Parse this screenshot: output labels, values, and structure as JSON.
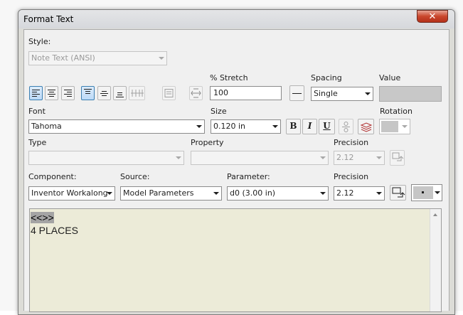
{
  "window": {
    "title": "Format Text",
    "close_glyph": "✕"
  },
  "style": {
    "label": "Style:",
    "value": "Note Text (ANSI)"
  },
  "stretch": {
    "label": "% Stretch",
    "value": "100"
  },
  "spacing": {
    "label": "Spacing",
    "value": "Single"
  },
  "value_field": {
    "label": "Value",
    "value": ""
  },
  "font": {
    "label": "Font",
    "value": "Tahoma"
  },
  "size": {
    "label": "Size",
    "value": "0.120 in"
  },
  "format_buttons": {
    "bold": "B",
    "italic": "I",
    "underline": "U"
  },
  "rotation": {
    "label": "Rotation"
  },
  "type": {
    "label": "Type",
    "value": ""
  },
  "property": {
    "label": "Property",
    "value": ""
  },
  "precision_top": {
    "label": "Precision",
    "value": "2.12"
  },
  "component": {
    "label": "Component:",
    "value": "Inventor Workalong"
  },
  "source": {
    "label": "Source:",
    "value": "Model Parameters"
  },
  "parameter": {
    "label": "Parameter:",
    "value": "d0 (3.00 in)"
  },
  "precision_bottom": {
    "label": "Precision",
    "value": "2.12"
  },
  "editor": {
    "line1": "<<>>",
    "line2": "4 PLACES"
  },
  "colors": {
    "accent": "#3c7fb1",
    "editor_bg": "#ecebd8",
    "close": "#c9462c"
  }
}
